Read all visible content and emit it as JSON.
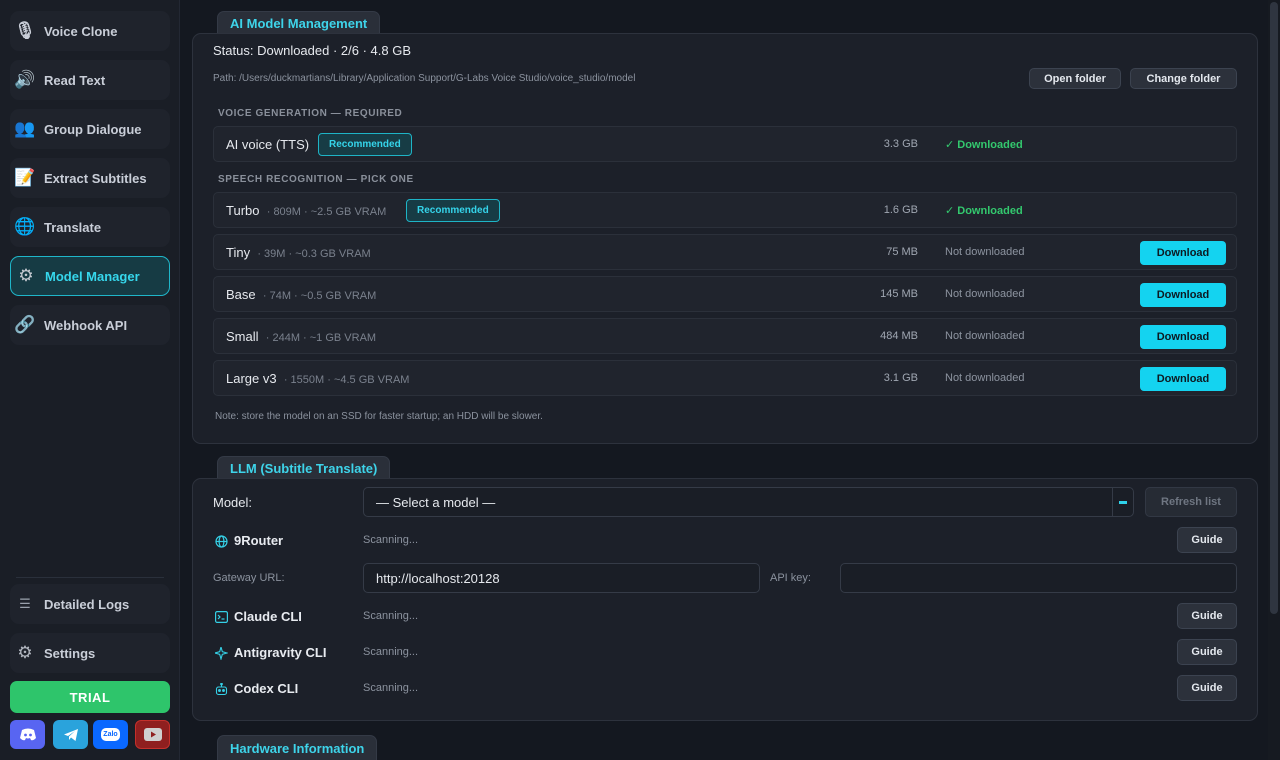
{
  "sidebar": {
    "items": [
      {
        "label": "Voice Clone",
        "icon": "🎙"
      },
      {
        "label": "Read Text",
        "icon": "🔊"
      },
      {
        "label": "Group Dialogue",
        "icon": "👥"
      },
      {
        "label": "Extract Subtitles",
        "icon": "📝"
      },
      {
        "label": "Translate",
        "icon": "🌐"
      },
      {
        "label": "Model Manager",
        "icon": "⚙"
      },
      {
        "label": "Webhook API",
        "icon": "🔗"
      }
    ],
    "bottom": [
      {
        "label": "Detailed Logs",
        "icon": "☰"
      },
      {
        "label": "Settings",
        "icon": "⚙"
      }
    ],
    "trial_label": "TRIAL",
    "social": [
      {
        "name": "discord",
        "color": "#5865f2"
      },
      {
        "name": "telegram",
        "color": "#2aa3dc"
      },
      {
        "name": "zalo",
        "label": "Zalo",
        "color": "#0a68ff"
      },
      {
        "name": "youtube",
        "color": "#c4302b"
      }
    ]
  },
  "ai_models": {
    "section_title": "AI Model Management",
    "status_line": "Status: Downloaded  ·  2/6  ·  4.8 GB",
    "path": "Path: /Users/duckmartians/Library/Application Support/G-Labs Voice Studio/voice_studio/model",
    "open_folder": "Open folder",
    "change_folder": "Change folder",
    "group_voice": "VOICE GENERATION — REQUIRED",
    "group_speech": "SPEECH RECOGNITION — PICK ONE",
    "recommended": "Recommended",
    "download_label": "Download",
    "tts": {
      "name": "AI voice (TTS)",
      "size": "3.3 GB",
      "status": "✓ Downloaded"
    },
    "asr": [
      {
        "name": "Turbo",
        "spec": "· 809M · ~2.5 GB VRAM",
        "size": "1.6 GB",
        "status": "✓ Downloaded",
        "recommended": true
      },
      {
        "name": "Tiny",
        "spec": "· 39M · ~0.3 GB VRAM",
        "size": "75 MB",
        "status": "Not downloaded"
      },
      {
        "name": "Base",
        "spec": "· 74M · ~0.5 GB VRAM",
        "size": "145 MB",
        "status": "Not downloaded"
      },
      {
        "name": "Small",
        "spec": "· 244M · ~1 GB VRAM",
        "size": "484 MB",
        "status": "Not downloaded"
      },
      {
        "name": "Large v3",
        "spec": "· 1550M · ~4.5 GB VRAM",
        "size": "3.1 GB",
        "status": "Not downloaded"
      }
    ],
    "note": "Note: store the model on an SSD for faster startup; an HDD will be slower."
  },
  "llm": {
    "section_title": "LLM (Subtitle Translate)",
    "model_label": "Model:",
    "model_select": "— Select a model —",
    "refresh": "Refresh list",
    "guide": "Guide",
    "scanning": "Scanning...",
    "router_name": "9Router",
    "gateway_label": "Gateway URL:",
    "gateway_value": "http://localhost:20128",
    "api_key_label": "API key:",
    "api_key_value": "",
    "clis": [
      "Claude CLI",
      "Antigravity CLI",
      "Codex CLI"
    ]
  },
  "hardware": {
    "section_title": "Hardware Information"
  }
}
